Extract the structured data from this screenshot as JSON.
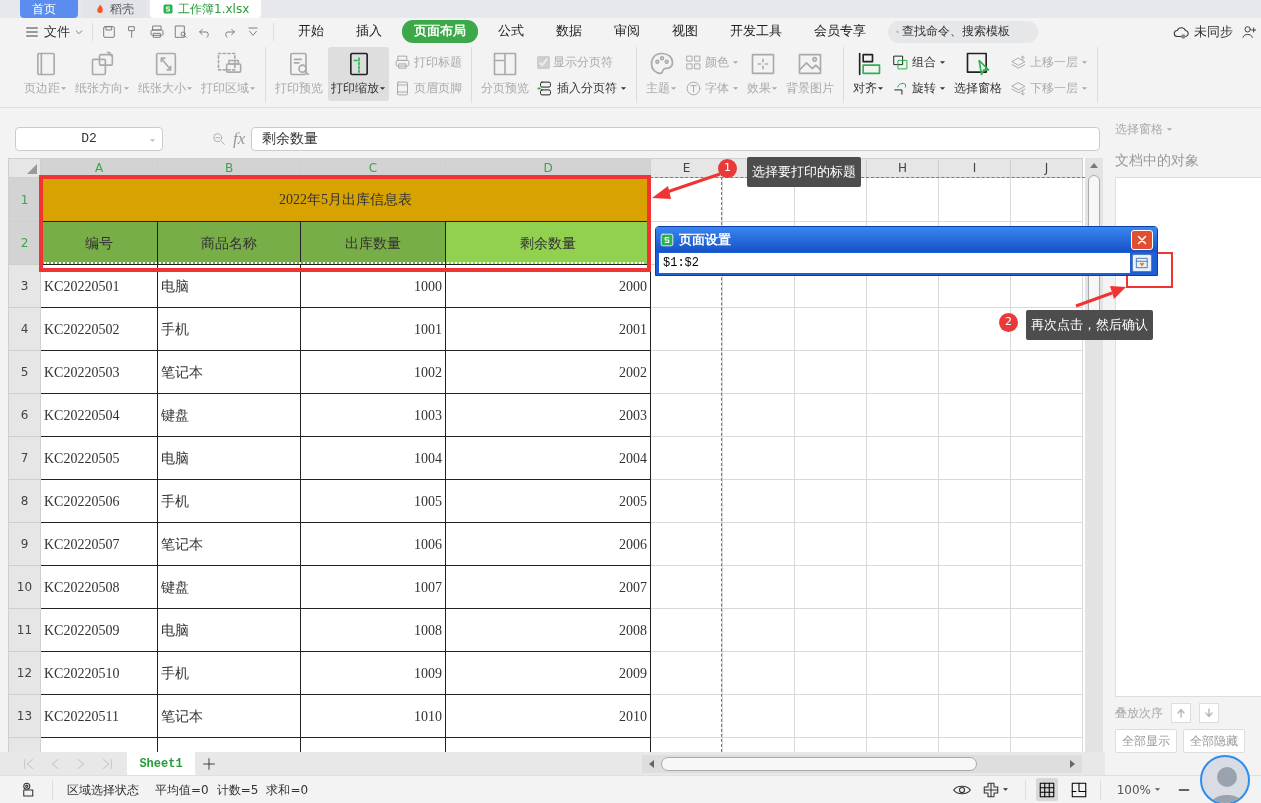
{
  "window_tabs": [
    {
      "label": "首页",
      "selected": false,
      "kind": "home"
    },
    {
      "label": "稻壳",
      "selected": false
    },
    {
      "label": "工作簿1.xlsx",
      "selected": true
    }
  ],
  "menu": {
    "file": "文件",
    "tabs": [
      {
        "label": "开始",
        "selected": false
      },
      {
        "label": "插入",
        "selected": false
      },
      {
        "label": "页面布局",
        "selected": true
      },
      {
        "label": "公式",
        "selected": false
      },
      {
        "label": "数据",
        "selected": false
      },
      {
        "label": "审阅",
        "selected": false
      },
      {
        "label": "视图",
        "selected": false
      },
      {
        "label": "开发工具",
        "selected": false
      },
      {
        "label": "会员专享",
        "selected": false
      }
    ],
    "search": {
      "placeholder": "查找命令、搜索模板"
    },
    "sync": "未同步"
  },
  "ribbon": {
    "groups": [
      {
        "items": [
          {
            "kind": "large",
            "label": "页边距",
            "dropdown": true,
            "disabled": true,
            "pressed": false
          },
          {
            "kind": "large",
            "label": "纸张方向",
            "dropdown": true,
            "disabled": true,
            "pressed": false
          },
          {
            "kind": "large",
            "label": "纸张大小",
            "dropdown": true,
            "disabled": true,
            "pressed": false
          },
          {
            "kind": "large",
            "label": "打印区域",
            "dropdown": true,
            "disabled": true,
            "pressed": false
          }
        ]
      },
      {
        "items": [
          {
            "kind": "large",
            "label": "打印预览",
            "dropdown": false,
            "disabled": true,
            "pressed": false
          },
          {
            "kind": "large",
            "label": "打印缩放",
            "dropdown": true,
            "disabled": false,
            "pressed": true
          },
          {
            "kind": "stack",
            "items": [
              {
                "kind": "small",
                "label": "打印标题",
                "dropdown": false,
                "disabled": true
              },
              {
                "kind": "small",
                "label": "页眉页脚",
                "dropdown": false,
                "disabled": true
              }
            ]
          }
        ]
      },
      {
        "items": [
          {
            "kind": "large",
            "label": "分页预览",
            "dropdown": false,
            "disabled": true,
            "pressed": false
          },
          {
            "kind": "stack",
            "items": [
              {
                "kind": "checkbox",
                "label": "显示分页符",
                "checked": true,
                "disabled": true
              },
              {
                "kind": "small",
                "label": "插入分页符",
                "dropdown": true,
                "disabled": false
              }
            ]
          }
        ]
      },
      {
        "items": [
          {
            "kind": "large",
            "label": "主题",
            "dropdown": true,
            "disabled": true,
            "pressed": false
          },
          {
            "kind": "stack",
            "items": [
              {
                "kind": "small",
                "label": "颜色",
                "dropdown": true,
                "disabled": true
              },
              {
                "kind": "small",
                "label": "字体",
                "dropdown": true,
                "disabled": true
              }
            ]
          },
          {
            "kind": "large",
            "label": "效果",
            "dropdown": true,
            "disabled": true,
            "pressed": false
          },
          {
            "kind": "large",
            "label": "背景图片",
            "dropdown": false,
            "disabled": true,
            "pressed": false
          }
        ]
      },
      {
        "items": [
          {
            "kind": "large",
            "label": "对齐",
            "dropdown": true,
            "disabled": false,
            "pressed": false
          },
          {
            "kind": "stack",
            "items": [
              {
                "kind": "small",
                "label": "组合",
                "dropdown": true,
                "disabled": false
              },
              {
                "kind": "small",
                "label": "旋转",
                "dropdown": true,
                "disabled": false
              }
            ]
          },
          {
            "kind": "large",
            "label": "选择窗格",
            "dropdown": false,
            "disabled": false,
            "pressed": false
          },
          {
            "kind": "stack",
            "items": [
              {
                "kind": "small",
                "label": "上移一层",
                "dropdown": true,
                "disabled": true
              },
              {
                "kind": "small",
                "label": "下移一层",
                "dropdown": true,
                "disabled": true
              }
            ]
          }
        ]
      }
    ]
  },
  "formula_bar": {
    "name_box": "D2",
    "fx_label": "fx",
    "formula": "剩余数量"
  },
  "sheet": {
    "columns": [
      {
        "label": "A",
        "selected": true
      },
      {
        "label": "B",
        "selected": true
      },
      {
        "label": "C",
        "selected": true
      },
      {
        "label": "D",
        "selected": true
      },
      {
        "label": "E",
        "selected": false
      },
      {
        "label": "H",
        "selected": false
      },
      {
        "label": "I",
        "selected": false
      },
      {
        "label": "J",
        "selected": false
      }
    ],
    "row_headers": [
      {
        "label": "1",
        "selected": true
      },
      {
        "label": "2",
        "selected": true
      },
      {
        "label": "3",
        "selected": false
      },
      {
        "label": "4",
        "selected": false
      },
      {
        "label": "5",
        "selected": false
      },
      {
        "label": "6",
        "selected": false
      },
      {
        "label": "7",
        "selected": false
      },
      {
        "label": "8",
        "selected": false
      },
      {
        "label": "9",
        "selected": false
      },
      {
        "label": "10",
        "selected": false
      },
      {
        "label": "11",
        "selected": false
      },
      {
        "label": "12",
        "selected": false
      },
      {
        "label": "13",
        "selected": false
      }
    ],
    "title": "2022年5月出库信息表",
    "headers": [
      {
        "text": "编号",
        "selected": false
      },
      {
        "text": "商品名称",
        "selected": false
      },
      {
        "text": "出库数量",
        "selected": false
      },
      {
        "text": "剩余数量",
        "selected": true
      }
    ],
    "rows": [
      {
        "cells": [
          "KC20220501",
          "电脑",
          "1000",
          "2000"
        ]
      },
      {
        "cells": [
          "KC20220502",
          "手机",
          "1001",
          "2001"
        ]
      },
      {
        "cells": [
          "KC20220503",
          "笔记本",
          "1002",
          "2002"
        ]
      },
      {
        "cells": [
          "KC20220504",
          "键盘",
          "1003",
          "2003"
        ]
      },
      {
        "cells": [
          "KC20220505",
          "电脑",
          "1004",
          "2004"
        ]
      },
      {
        "cells": [
          "KC20220506",
          "手机",
          "1005",
          "2005"
        ]
      },
      {
        "cells": [
          "KC20220507",
          "笔记本",
          "1006",
          "2006"
        ]
      },
      {
        "cells": [
          "KC20220508",
          "键盘",
          "1007",
          "2007"
        ]
      },
      {
        "cells": [
          "KC20220509",
          "电脑",
          "1008",
          "2008"
        ]
      },
      {
        "cells": [
          "KC20220510",
          "手机",
          "1009",
          "2009"
        ]
      },
      {
        "cells": [
          "KC20220511",
          "笔记本",
          "1010",
          "2010"
        ]
      }
    ]
  },
  "dialog": {
    "title": "页面设置",
    "value": "$1:$2"
  },
  "callouts": [
    {
      "number": "1",
      "text": "选择要打印的标题"
    },
    {
      "number": "2",
      "text": "再次点击，然后确认"
    }
  ],
  "sheet_tabs": [
    {
      "label": "Sheet1",
      "selected": true
    }
  ],
  "pane": {
    "title": "选择窗格",
    "objects_label": "文档中的对象",
    "order_label": "叠放次序",
    "buttons": [
      "全部显示",
      "全部隐藏"
    ]
  },
  "status_bar": {
    "mode": "区域选择状态",
    "stats": [
      "平均值=0",
      "计数=5",
      "求和=0"
    ],
    "zoom": "100%"
  }
}
